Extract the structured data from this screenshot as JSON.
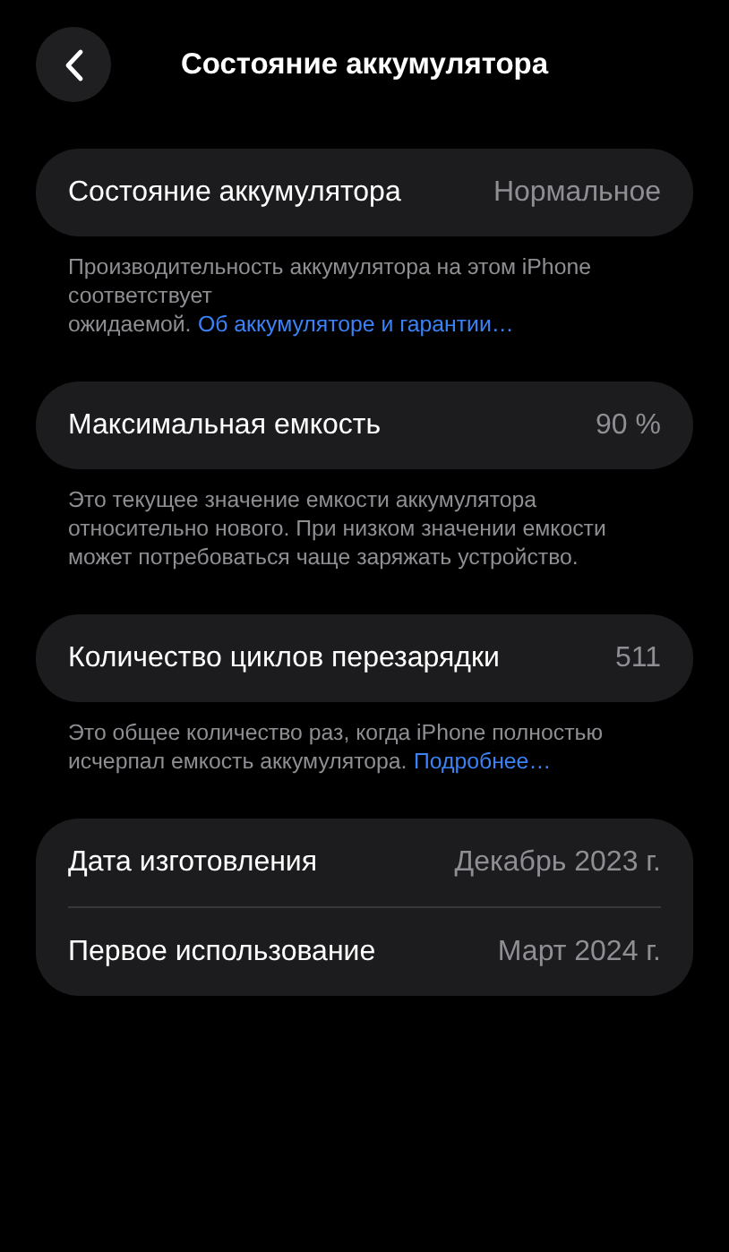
{
  "header": {
    "title": "Состояние аккумулятора"
  },
  "sections": [
    {
      "rows": [
        {
          "label": "Состояние аккумулятора",
          "value": "Нормальное"
        }
      ],
      "note": {
        "text": "Производительность аккумулятора на этом iPhone соответствует ожидаемой.",
        "link": "Об аккумуляторе и гарантии…"
      }
    },
    {
      "rows": [
        {
          "label": "Максимальная емкость",
          "value": "90 %"
        }
      ],
      "note": {
        "text": "Это текущее значение емкости аккумулятора относительно нового. При низком значении емкости может потребоваться чаще заряжать устройство."
      }
    },
    {
      "rows": [
        {
          "label": "Количество циклов перезарядки",
          "value": "511"
        }
      ],
      "note": {
        "text": "Это общее количество раз, когда iPhone полностью исчерпал емкость аккумулятора.",
        "link": "Подробнее…"
      }
    },
    {
      "rows": [
        {
          "label": "Дата изготовления",
          "value": "Декабрь 2023 г."
        },
        {
          "label": "Первое использование",
          "value": "Март 2024 г."
        }
      ]
    }
  ]
}
